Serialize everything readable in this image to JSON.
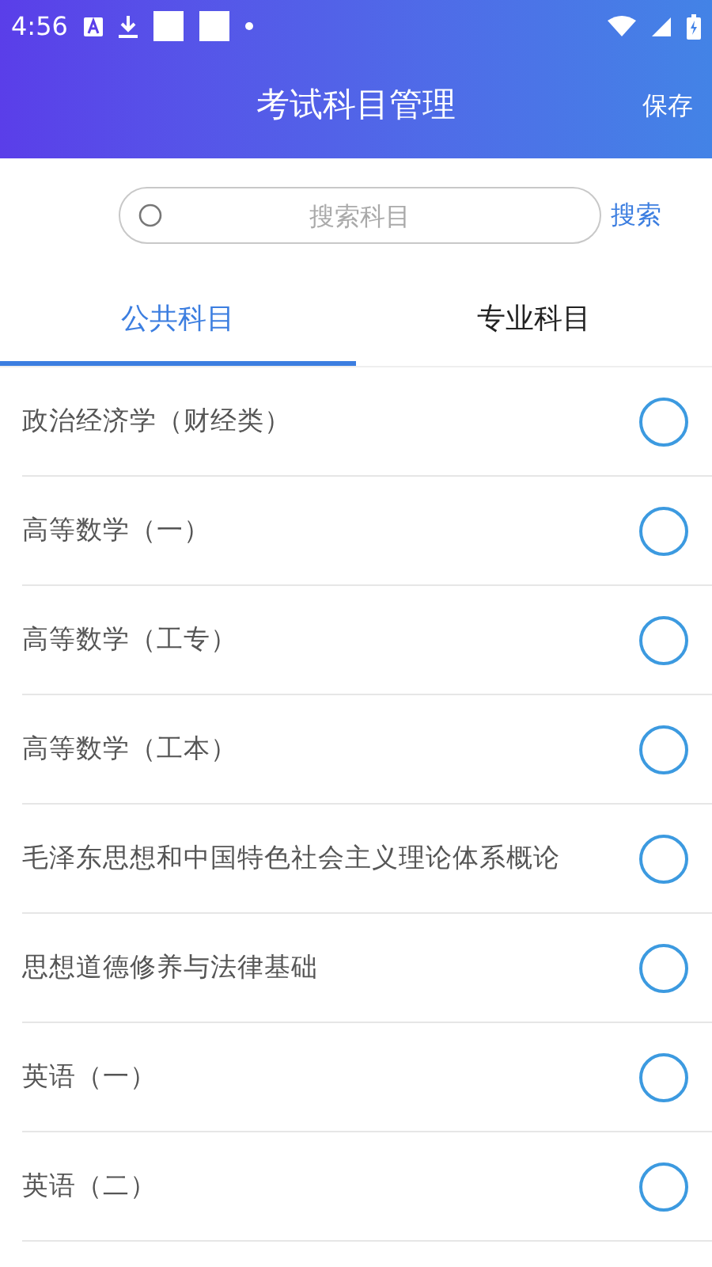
{
  "status_bar": {
    "time": "4:56"
  },
  "header": {
    "title": "考试科目管理",
    "action": "保存"
  },
  "search": {
    "placeholder": "搜索科目",
    "button": "搜索"
  },
  "tabs": [
    {
      "label": "公共科目",
      "selected": true
    },
    {
      "label": "专业科目",
      "selected": false
    }
  ],
  "subjects": [
    {
      "name": "政治经济学（财经类）",
      "checked": false
    },
    {
      "name": "高等数学（一）",
      "checked": false
    },
    {
      "name": "高等数学（工专）",
      "checked": false
    },
    {
      "name": "高等数学（工本）",
      "checked": false
    },
    {
      "name": "毛泽东思想和中国特色社会主义理论体系概论",
      "checked": false
    },
    {
      "name": "思想道德修养与法律基础",
      "checked": false
    },
    {
      "name": "英语（一）",
      "checked": false
    },
    {
      "name": "英语（二）",
      "checked": false
    }
  ]
}
